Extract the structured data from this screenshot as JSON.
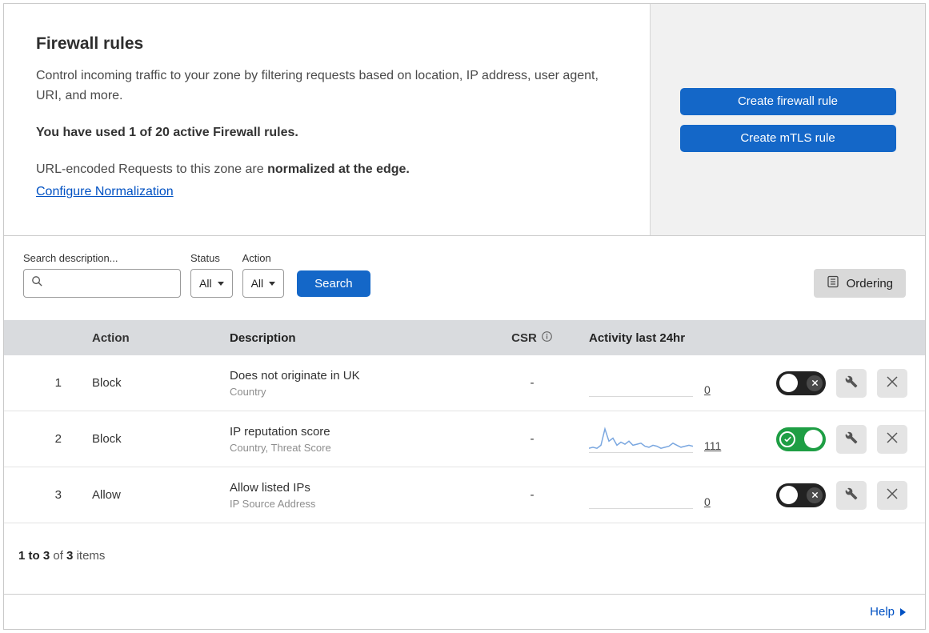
{
  "accent": {
    "primary_blue": "#1467c8",
    "link_blue": "#0051c3",
    "toggle_on_green": "#1e9e44",
    "toggle_off_dark": "#222222",
    "sparkline_blue": "#7aa7e0"
  },
  "icons": {
    "search": "search-icon",
    "chevron_down": "chevron-down-icon",
    "ordering": "ordering-list-icon",
    "info": "info-icon",
    "check": "check-icon",
    "close": "close-icon",
    "wrench": "wrench-icon",
    "help_arrow": "arrow-right-icon"
  },
  "header": {
    "title": "Firewall rules",
    "description": "Control incoming traffic to your zone by filtering requests based on location, IP address, user agent, URI, and more.",
    "usage_notice": "You have used 1 of 20 active Firewall rules.",
    "normalization_text": "URL-encoded Requests to this zone are",
    "normalization_bold": "normalized at the edge.",
    "normalization_link": "Configure Normalization",
    "buttons": {
      "create_firewall_rule": "Create firewall rule",
      "create_mtls_rule": "Create mTLS rule"
    }
  },
  "filters": {
    "search_label": "Search description...",
    "status_label": "Status",
    "status_value": "All",
    "action_label": "Action",
    "action_value": "All",
    "search_button": "Search",
    "ordering_button": "Ordering"
  },
  "table": {
    "headers": {
      "action": "Action",
      "description": "Description",
      "csr": "CSR",
      "activity": "Activity last 24hr"
    },
    "rows": [
      {
        "priority": "1",
        "action": "Block",
        "description": "Does not originate in UK",
        "fields": "Country",
        "csr": "-",
        "activity": "0",
        "enabled": false,
        "sparkline": []
      },
      {
        "priority": "2",
        "action": "Block",
        "description": "IP reputation score",
        "fields": "Country, Threat Score",
        "csr": "-",
        "activity": "111",
        "enabled": true,
        "sparkline": [
          3,
          4,
          3,
          6,
          22,
          10,
          13,
          6,
          9,
          7,
          10,
          6,
          7,
          8,
          5,
          4,
          6,
          5,
          3,
          4,
          5,
          8,
          6,
          4,
          5,
          6,
          5
        ]
      },
      {
        "priority": "3",
        "action": "Allow",
        "description": "Allow listed IPs",
        "fields": "IP Source Address",
        "csr": "-",
        "activity": "0",
        "enabled": false,
        "sparkline": []
      }
    ]
  },
  "footer": {
    "range": "1 to 3",
    "of_text": "of",
    "total": "3",
    "items_text": "items",
    "help_link": "Help"
  }
}
